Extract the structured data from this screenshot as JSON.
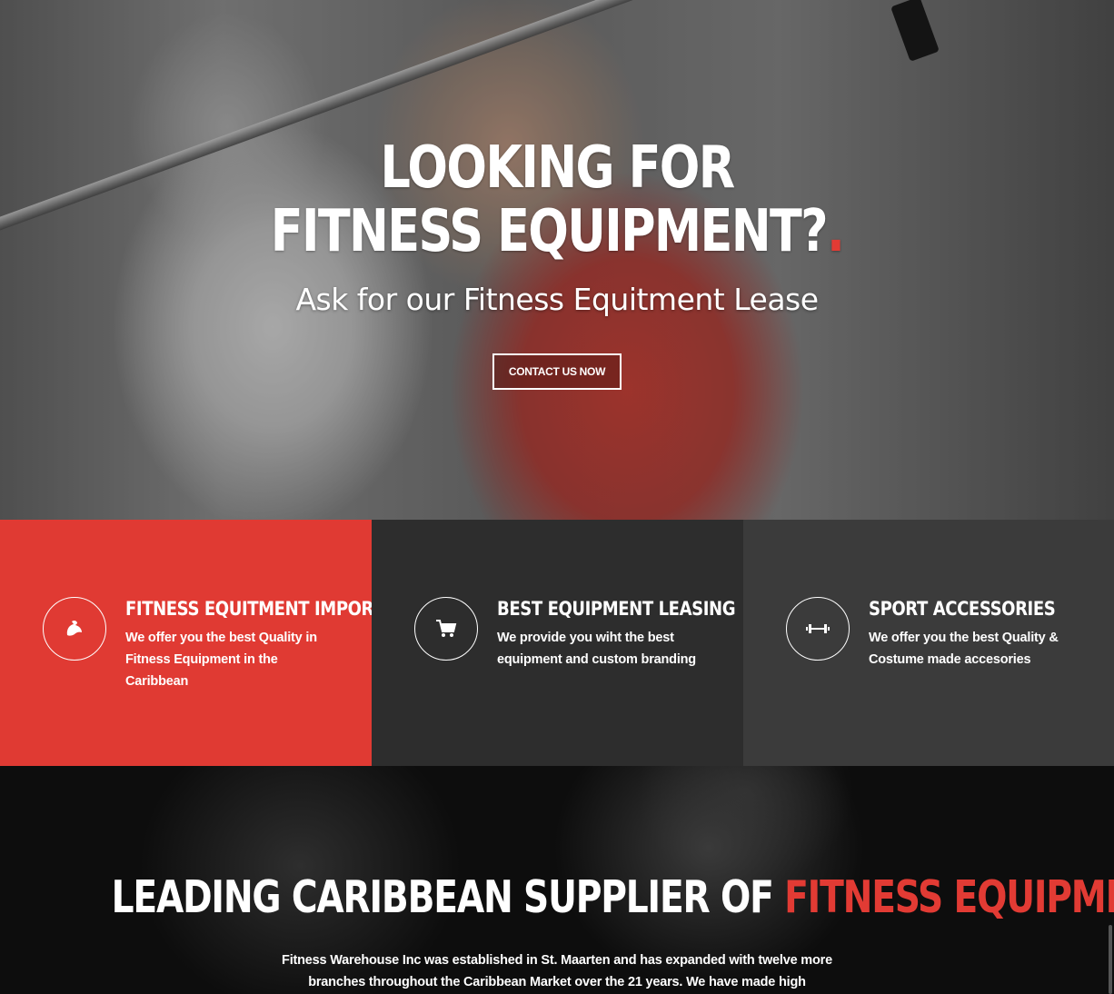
{
  "hero": {
    "title_line1": "LOOKING FOR",
    "title_line2": "FITNESS EQUIPMENT?",
    "title_dot": ".",
    "subtitle": "Ask for our Fitness Equitment Lease",
    "cta_label": "CONTACT US NOW"
  },
  "features": [
    {
      "icon": "flexed-arm-icon",
      "title": "FITNESS EQUITMENT IMPORT",
      "description": "We offer you the best Quality in Fitness Equipment in the Caribbean",
      "background": "#e03a33"
    },
    {
      "icon": "shopping-cart-icon",
      "title": "BEST EQUIPMENT LEASING",
      "description": "We provide you wiht the best equipment and custom branding",
      "background": "#2d2d2d"
    },
    {
      "icon": "dumbbell-icon",
      "title": "SPORT ACCESSORIES",
      "description": "We offer you the best Quality & Costume made accesories",
      "background": "#3b3b3b"
    }
  ],
  "about": {
    "title_main": "LEADING CARIBBEAN SUPPLIER OF ",
    "title_accent": "FITNESS EQUIPMENT",
    "text": "Fitness Warehouse Inc was established in St. Maarten and has expanded with twelve more branches throughout the Caribbean Market over the 21 years. We have made high"
  },
  "colors": {
    "accent": "#e23b34",
    "dark": "#2d2d2d",
    "darker": "#3b3b3b"
  }
}
